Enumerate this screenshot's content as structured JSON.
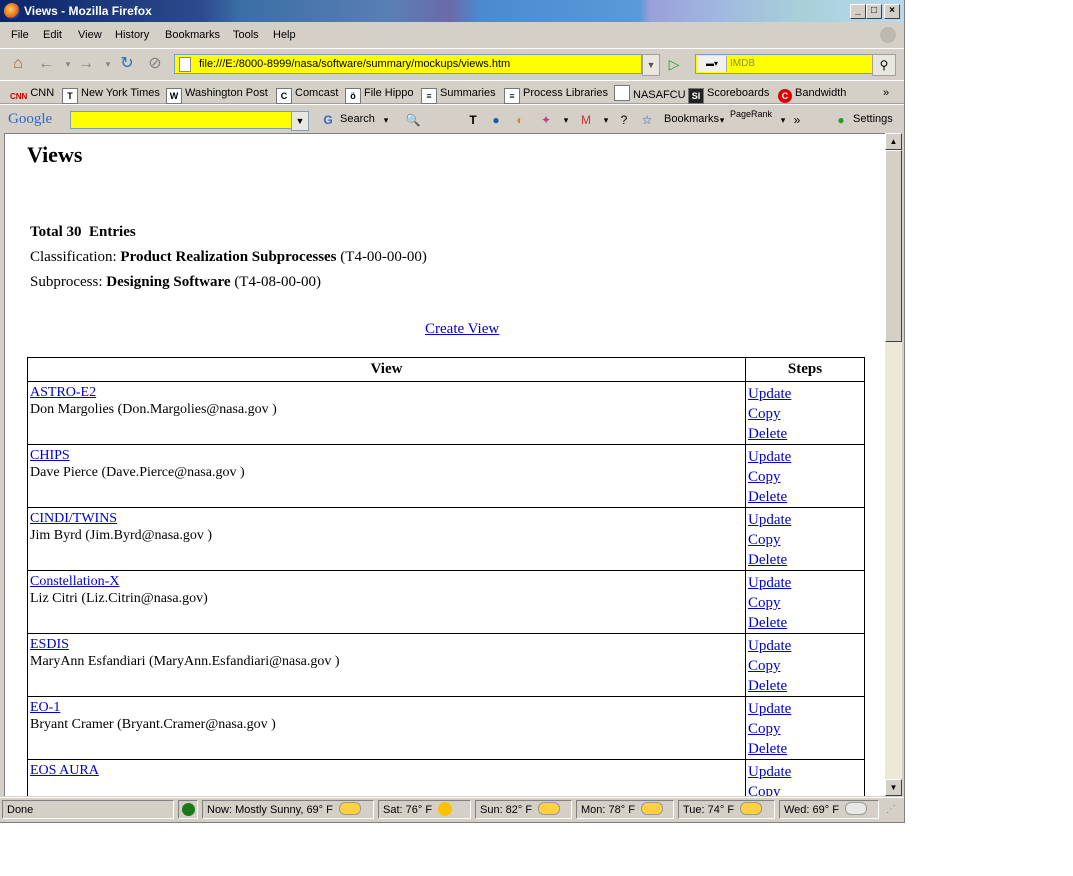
{
  "window": {
    "title": "Views - Mozilla Firefox"
  },
  "menu": [
    "File",
    "Edit",
    "View",
    "History",
    "Bookmarks",
    "Tools",
    "Help"
  ],
  "nav": {
    "url": "file:///E:/8000-8999/nasa/software/summary/mockups/views.htm",
    "search_placeholder": "IMDB"
  },
  "bookmarks": [
    {
      "label": "CNN",
      "icon": "cnn-icon"
    },
    {
      "label": "New York Times",
      "icon": "nyt-icon"
    },
    {
      "label": "Washington Post",
      "icon": "wapo-icon"
    },
    {
      "label": "Comcast",
      "icon": "comcast-icon"
    },
    {
      "label": "File Hippo",
      "icon": "filehippo-icon"
    },
    {
      "label": "Summaries",
      "icon": "page-icon"
    },
    {
      "label": "Process Libraries",
      "icon": "page-icon"
    },
    {
      "label": "NASAFCU",
      "icon": "page-icon"
    },
    {
      "label": "Scoreboards",
      "icon": "si-icon"
    },
    {
      "label": "Bandwidth",
      "icon": "bandwidth-icon"
    }
  ],
  "google": {
    "logo": "Google",
    "search_label": "Search",
    "bookmarks_label": "Bookmarks",
    "pagerank_label": "PageRank",
    "settings_label": "Settings"
  },
  "page": {
    "title": "Views",
    "total_prefix": "Total 30",
    "total_suffix": "Entries",
    "classification_label": "Classification:",
    "classification_name": "Product Realization Subprocesses",
    "classification_code": "(T4-00-00-00)",
    "subprocess_label": "Subprocess:",
    "subprocess_name": "Designing Software",
    "subprocess_code": "(T4-08-00-00)",
    "create_link": "Create View",
    "table_headers": [
      "View",
      "Steps"
    ],
    "steps": [
      "Update",
      "Copy",
      "Delete"
    ],
    "rows": [
      {
        "name": "ASTRO-E2",
        "owner": "Don Margolies (Don.Margolies@nasa.gov )"
      },
      {
        "name": "CHIPS",
        "owner": "Dave Pierce (Dave.Pierce@nasa.gov )"
      },
      {
        "name": "CINDI/TWINS",
        "owner": "Jim Byrd (Jim.Byrd@nasa.gov )"
      },
      {
        "name": "Constellation-X",
        "owner": "Liz Citri (Liz.Citrin@nasa.gov)"
      },
      {
        "name": "ESDIS",
        "owner": "MaryAnn Esfandiari (MaryAnn.Esfandiari@nasa.gov )"
      },
      {
        "name": "EO-1",
        "owner": "Bryant Cramer (Bryant.Cramer@nasa.gov )"
      },
      {
        "name": "EOS AURA",
        "owner": ""
      }
    ]
  },
  "status": {
    "text": "Done",
    "weather": [
      {
        "label": "Now: Mostly Sunny, 69° F",
        "icon": "partly-sunny-icon"
      },
      {
        "label": "Sat: 76° F",
        "icon": "sunny-icon"
      },
      {
        "label": "Sun: 82° F",
        "icon": "partly-sunny-icon"
      },
      {
        "label": "Mon: 78° F",
        "icon": "partly-sunny-icon"
      },
      {
        "label": "Tue: 74° F",
        "icon": "partly-sunny-icon"
      },
      {
        "label": "Wed: 69° F",
        "icon": "cloudy-icon"
      }
    ]
  }
}
